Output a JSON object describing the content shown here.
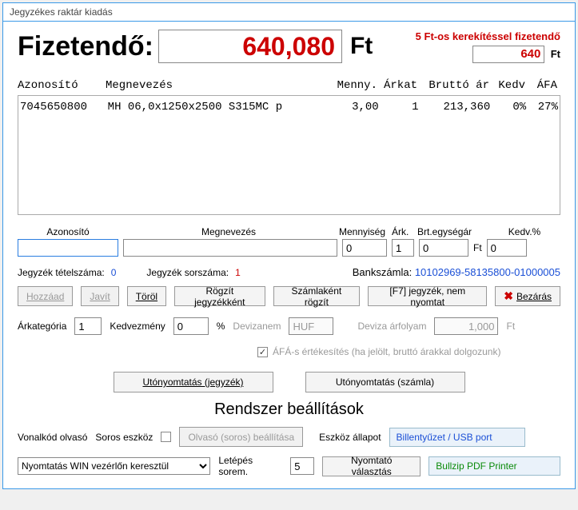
{
  "window": {
    "title": "Jegyzékes raktár kiadás"
  },
  "top": {
    "fizetendo_label": "Fizetendő:",
    "fizetendo_value": "640,080",
    "ft": "Ft",
    "rounding_label": "5 Ft-os kerekítéssel fizetendő",
    "rounded_value": "640",
    "rounded_ft": "Ft"
  },
  "table": {
    "headers": {
      "azonosito": "Azonosító",
      "megnevezes": "Megnevezés",
      "menny": "Menny.",
      "arkat": "Árkat",
      "brutto": "Bruttó ár",
      "kedv": "Kedv",
      "afa": "ÁFA"
    },
    "rows": [
      {
        "azonosito": "7045650800",
        "megnevezes": "MH 06,0x1250x2500 S315MC p",
        "menny": "3,00",
        "arkat": "1",
        "brutto": "213,360",
        "kedv": "0%",
        "afa": "27%"
      }
    ]
  },
  "fields": {
    "labels": {
      "azonosito": "Azonosító",
      "megnevezes": "Megnevezés",
      "mennyiseg": "Mennyiség",
      "ark": "Árk.",
      "brt": "Brt.egységár",
      "kedv": "Kedv.%"
    },
    "values": {
      "azonosito": "",
      "megnevezes": "",
      "mennyiseg": "0",
      "ark": "1",
      "brt": "0",
      "kedv": "0",
      "ft": "Ft"
    }
  },
  "info": {
    "tetel_label": "Jegyzék tételszáma:",
    "tetel_value": "0",
    "sorszam_label": "Jegyzék sorszáma:",
    "sorszam_value": "1",
    "bank_label": "Bankszámla:",
    "bank_value": "10102969-58135800-01000005"
  },
  "buttons": {
    "hozzaad": "Hozzáad",
    "javit": "Javít",
    "torol": "Töröl",
    "rogzit_jegyzek": "Rögzít jegyzékként",
    "szamlakent": "Számlaként rögzít",
    "f7": "[F7] jegyzék, nem nyomtat",
    "bezaras": "Bezárás"
  },
  "params": {
    "arkategoria_label": "Árkategória",
    "arkategoria_value": "1",
    "kedvezmeny_label": "Kedvezmény",
    "kedvezmeny_value": "0",
    "percent": "%",
    "devizanem_label": "Devizanem",
    "devizanem_value": "HUF",
    "arfolyam_label": "Deviza árfolyam",
    "arfolyam_value": "1,000",
    "ft": "Ft"
  },
  "afa_check": {
    "checked": "✓",
    "label": "ÁFÁ-s értékesítés (ha jelölt, bruttó árakkal dolgozunk)"
  },
  "reprint": {
    "jegyzek": "Utónyomtatás (jegyzék)",
    "szamla": "Utónyomtatás (számla)"
  },
  "system": {
    "title": "Rendszer beállítások",
    "vonalkod_label": "Vonalkód olvasó",
    "soros_label": "Soros eszköz",
    "olvaso_btn": "Olvasó (soros) beállítása",
    "allapot_label": "Eszköz állapot",
    "allapot_value": "Billentyűzet / USB port",
    "nyomtatas_select": "Nyomtatás WIN vezérlőn keresztül",
    "letepes_label": "Letépés sorem.",
    "letepes_value": "5",
    "nyomtato_btn": "Nyomtató választás",
    "printer_value": "Bullzip PDF Printer"
  }
}
